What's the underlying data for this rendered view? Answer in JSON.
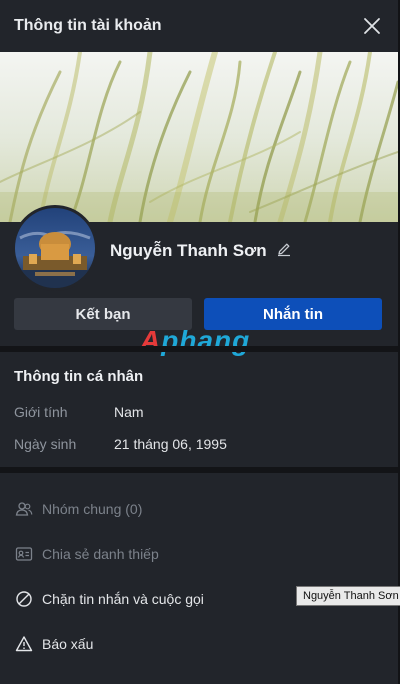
{
  "header": {
    "title": "Thông tin tài khoản"
  },
  "profile": {
    "name": "Nguyễn Thanh Sơn"
  },
  "actions": {
    "add_friend": "Kết bạn",
    "message": "Nhắn tin"
  },
  "watermark": {
    "part1": "A",
    "part2": "phang"
  },
  "personal_info": {
    "title": "Thông tin cá nhân",
    "fields": [
      {
        "label": "Giới tính",
        "value": "Nam"
      },
      {
        "label": "Ngày sinh",
        "value": "21 tháng 06, 1995"
      }
    ]
  },
  "menu": [
    {
      "label": "Nhóm chung (0)",
      "icon": "group-icon",
      "enabled": false
    },
    {
      "label": "Chia sẻ danh thiếp",
      "icon": "contact-card-icon",
      "enabled": false
    },
    {
      "label": "Chặn tin nhắn và cuộc gọi",
      "icon": "block-icon",
      "enabled": true
    },
    {
      "label": "Báo xấu",
      "icon": "warning-icon",
      "enabled": true
    }
  ],
  "tooltip": {
    "text": "Nguyễn Thanh Sơn"
  }
}
